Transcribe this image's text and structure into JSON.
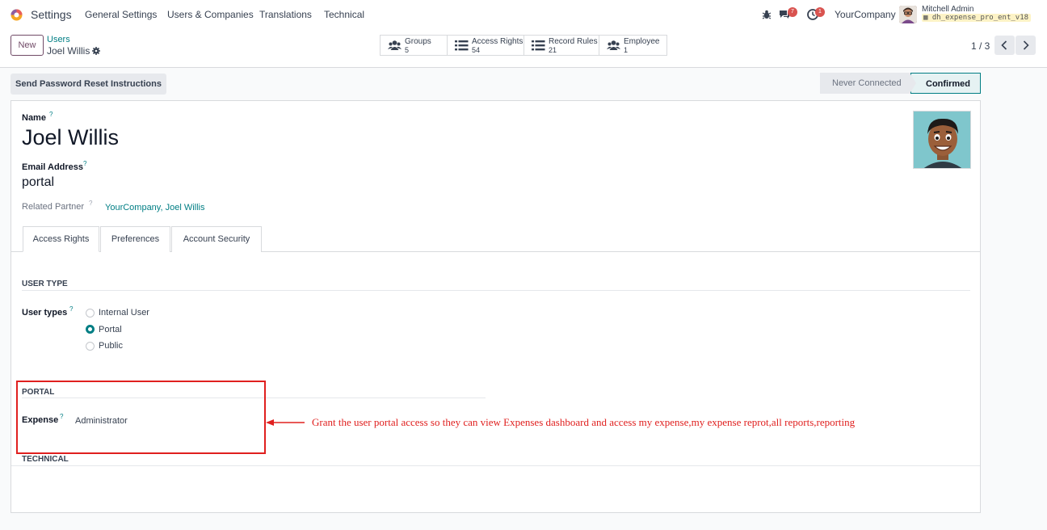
{
  "navbar": {
    "app_title": "Settings",
    "menus": [
      "General Settings",
      "Users & Companies",
      "Translations",
      "Technical"
    ],
    "messages_count": "7",
    "activities_count": "1",
    "company": "YourCompany",
    "user_name": "Mitchell Admin",
    "database": "dh_expense_pro_ent_v18"
  },
  "control": {
    "new_label": "New",
    "breadcrumb_parent": "Users",
    "breadcrumb_current": "Joel Willis",
    "smart_buttons": [
      {
        "label": "Groups",
        "count": "5",
        "icon": "users-icon"
      },
      {
        "label": "Access Rights",
        "count": "54",
        "icon": "list-icon"
      },
      {
        "label": "Record Rules",
        "count": "21",
        "icon": "list-icon"
      },
      {
        "label": "Employee",
        "count": "1",
        "icon": "users-icon"
      }
    ],
    "pager": "1 / 3"
  },
  "actions": {
    "reset_label": "Send Password Reset Instructions",
    "status_never": "Never Connected",
    "status_confirmed": "Confirmed"
  },
  "form": {
    "name_label": "Name",
    "name_value": "Joel Willis",
    "email_label": "Email Address",
    "email_value": "portal",
    "related_partner_label": "Related Partner",
    "related_partner_value": "YourCompany, Joel Willis",
    "help_mark": "?",
    "tabs": [
      "Access Rights",
      "Preferences",
      "Account Security"
    ],
    "user_type_title": "USER TYPE",
    "user_types_label": "User types",
    "user_type_options": [
      "Internal User",
      "Portal",
      "Public"
    ],
    "portal_title": "PORTAL",
    "expense_label": "Expense",
    "expense_value": "Administrator",
    "technical_title": "TECHNICAL"
  },
  "annotation": {
    "text": "Grant the user portal access so they can view Expenses dashboard and access my expense,my expense reprot,all reports,reporting",
    "color": "#e0201f"
  },
  "colors": {
    "brand": "#714b67",
    "accent": "#017e84"
  }
}
